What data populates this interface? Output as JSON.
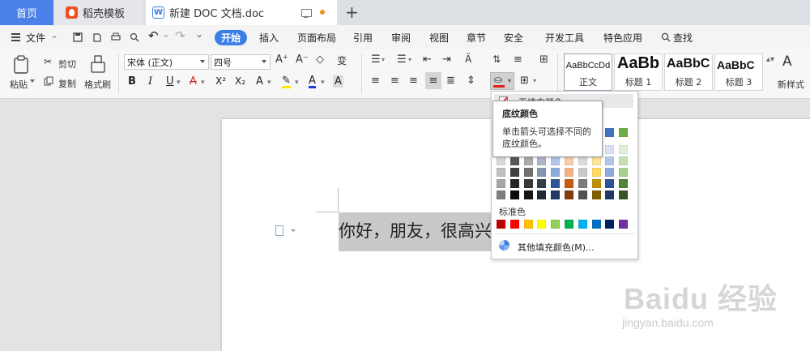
{
  "tabs": {
    "home": "首页",
    "templates": "稻壳模板",
    "document": "新建 DOC 文档.doc",
    "new_tab": "+"
  },
  "menu": {
    "file": "文件",
    "items": [
      "开始",
      "插入",
      "页面布局",
      "引用",
      "审阅",
      "视图",
      "章节",
      "安全",
      "开发工具",
      "特色应用",
      "查找"
    ]
  },
  "ribbon": {
    "paste": "粘贴",
    "cut": "剪切",
    "copy": "复制",
    "format_painter": "格式刷",
    "font_name": "宋体 (正文)",
    "font_size": "四号",
    "bold": "B",
    "italic": "I",
    "underline": "U",
    "strike": "A",
    "superscript": "X²",
    "subscript": "X₂",
    "styles": [
      {
        "sample": "AaBbCcDd",
        "name": "正文"
      },
      {
        "sample": "AaBb",
        "name": "标题 1"
      },
      {
        "sample": "AaBbC",
        "name": "标题 2"
      },
      {
        "sample": "AaBbC",
        "name": "标题 3"
      }
    ],
    "new_style": "新样式"
  },
  "document": {
    "text": "你好，朋友，很高兴"
  },
  "shading_dropdown": {
    "no_color": "无填充颜色",
    "standard_label": "标准色",
    "more_colors": "其他填充颜色(M)...",
    "theme_top_row": [
      "#ffffff",
      "#000000",
      "#e7e6e6",
      "#44546a",
      "#4472c4",
      "#ed7d31",
      "#a5a5a5",
      "#ffc000",
      "#4472c4",
      "#70ad47"
    ],
    "theme_shades": [
      [
        "#f2f2f2",
        "#7f7f7f",
        "#d0cece",
        "#d6dce4",
        "#d9e2f3",
        "#fbe5d5",
        "#ededed",
        "#fff2cc",
        "#d9e2f3",
        "#e2efd9"
      ],
      [
        "#d8d8d8",
        "#595959",
        "#aeabab",
        "#adb9ca",
        "#b4c6e7",
        "#f7cbac",
        "#dbdbdb",
        "#fee599",
        "#b4c6e7",
        "#c5e0b3"
      ],
      [
        "#bfbfbf",
        "#3f3f3f",
        "#757070",
        "#8496b0",
        "#8eaadb",
        "#f4b183",
        "#c9c9c9",
        "#ffd965",
        "#8eaadb",
        "#a8d08d"
      ],
      [
        "#a5a5a5",
        "#262626",
        "#3a3838",
        "#323f4f",
        "#2f5496",
        "#c55a11",
        "#7b7b7b",
        "#bf9000",
        "#2f5496",
        "#538135"
      ],
      [
        "#7f7f7f",
        "#0c0c0c",
        "#171616",
        "#222a35",
        "#1f3864",
        "#833c0b",
        "#525252",
        "#7f6000",
        "#1f3864",
        "#375623"
      ]
    ],
    "standard_colors": [
      "#c00000",
      "#ff0000",
      "#ffc000",
      "#ffff00",
      "#92d050",
      "#00b050",
      "#00b0f0",
      "#0070c0",
      "#002060",
      "#7030a0"
    ]
  },
  "tooltip": {
    "title": "底纹颜色",
    "description": "单击箭头可选择不同的底纹颜色。"
  },
  "watermark": {
    "text": "Baidu 经验",
    "url": "jingyan.baidu.com"
  }
}
